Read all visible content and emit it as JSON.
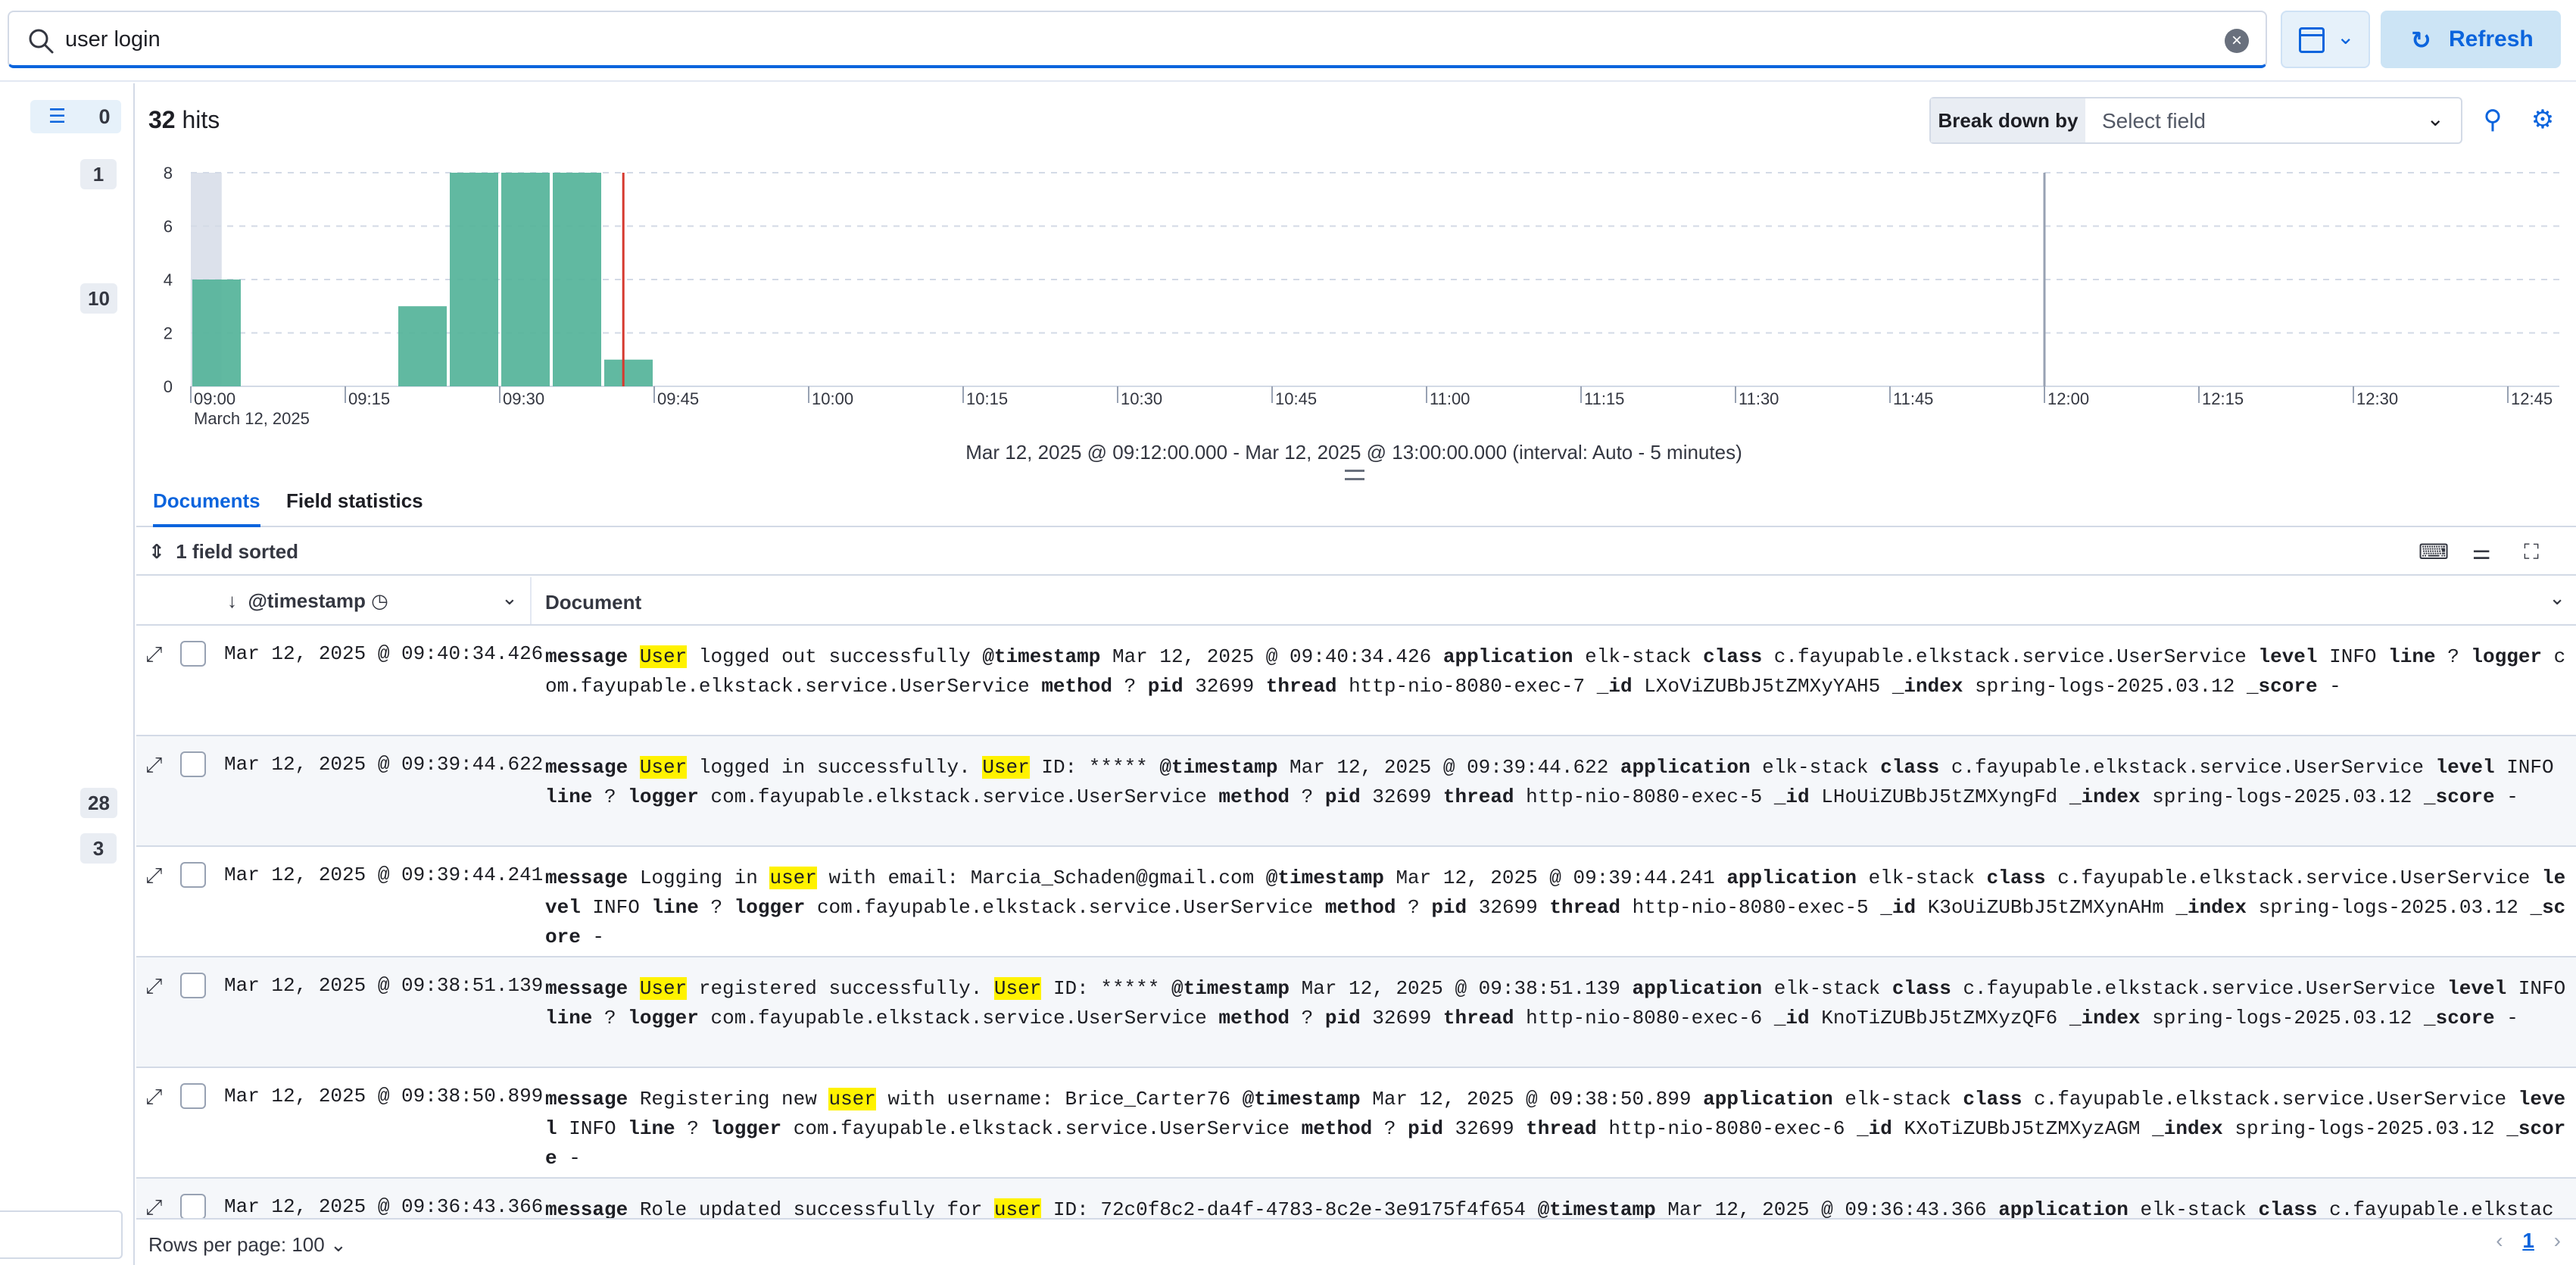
{
  "search": {
    "query": "user login"
  },
  "toolbar": {
    "refresh_label": "Refresh"
  },
  "sidebar": {
    "filter_count": "0",
    "counts": [
      {
        "value": "1"
      },
      {
        "value": "10"
      },
      {
        "value": "28"
      },
      {
        "value": "3"
      }
    ]
  },
  "results": {
    "hits_count": "32",
    "hits_label": "hits"
  },
  "breakdown": {
    "label": "Break down by",
    "placeholder": "Select field"
  },
  "chart_data": {
    "type": "bar",
    "x_unit": "time",
    "bin_minutes": 5,
    "bins": [
      {
        "start": "09:00",
        "value": 4
      },
      {
        "start": "09:05",
        "value": 0
      },
      {
        "start": "09:10",
        "value": 0
      },
      {
        "start": "09:15",
        "value": 0
      },
      {
        "start": "09:20",
        "value": 3
      },
      {
        "start": "09:25",
        "value": 8
      },
      {
        "start": "09:30",
        "value": 8
      },
      {
        "start": "09:35",
        "value": 8
      },
      {
        "start": "09:40",
        "value": 1
      }
    ],
    "x_ticks": [
      "09:00",
      "09:15",
      "09:30",
      "09:45",
      "10:00",
      "10:15",
      "10:30",
      "10:45",
      "11:00",
      "11:15",
      "11:30",
      "11:45",
      "12:00",
      "12:15",
      "12:30",
      "12:45"
    ],
    "x_sublabel": "March 12, 2025",
    "y_ticks": [
      0,
      2,
      4,
      6,
      8
    ],
    "ylim": [
      0,
      8
    ],
    "xlim": [
      "09:00",
      "12:50"
    ],
    "bar_color": "#54b399",
    "now_marker": "09:42",
    "out_of_range_before": "09:03",
    "end_marker": "12:00",
    "time_range": "Mar 12, 2025 @ 09:12:00.000 - Mar 12, 2025 @ 13:00:00.000 (interval: Auto - 5 minutes)"
  },
  "tabs": [
    {
      "label": "Documents",
      "active": true
    },
    {
      "label": "Field statistics",
      "active": false
    }
  ],
  "grid": {
    "sorted_label": "1 field sorted",
    "columns": {
      "timestamp": "@timestamp",
      "document": "Document"
    },
    "rows": [
      {
        "timestamp": "Mar 12, 2025 @ 09:40:34.426",
        "fields": [
          {
            "k": "message",
            "v": [
              {
                "t": "User",
                "hl": true
              },
              {
                "t": " logged out successfully"
              }
            ]
          },
          {
            "k": "@timestamp",
            "v": [
              {
                "t": "Mar 12, 2025 @ 09:40:34.426"
              }
            ]
          },
          {
            "k": "application",
            "v": [
              {
                "t": "elk-stack"
              }
            ]
          },
          {
            "k": "class",
            "v": [
              {
                "t": "c.fayupable.elkstack.service.UserService"
              }
            ]
          },
          {
            "k": "level",
            "v": [
              {
                "t": "INFO"
              }
            ]
          },
          {
            "k": "line",
            "v": [
              {
                "t": "?"
              }
            ]
          },
          {
            "k": "logger",
            "v": [
              {
                "t": "com.fayupable.elkstack.service.UserService"
              }
            ]
          },
          {
            "k": "method",
            "v": [
              {
                "t": "?"
              }
            ]
          },
          {
            "k": "pid",
            "v": [
              {
                "t": "32699"
              }
            ]
          },
          {
            "k": "thread",
            "v": [
              {
                "t": "http-nio-8080-exec-7"
              }
            ]
          },
          {
            "k": "_id",
            "v": [
              {
                "t": "LXoViZUBbJ5tZMXyYAH5"
              }
            ]
          },
          {
            "k": "_index",
            "v": [
              {
                "t": "spring-logs-2025.03.12"
              }
            ]
          },
          {
            "k": "_score",
            "v": [
              {
                "t": " -"
              }
            ]
          }
        ]
      },
      {
        "timestamp": "Mar 12, 2025 @ 09:39:44.622",
        "fields": [
          {
            "k": "message",
            "v": [
              {
                "t": "User",
                "hl": true
              },
              {
                "t": " logged in successfully. "
              },
              {
                "t": "User",
                "hl": true
              },
              {
                "t": " ID: *****"
              }
            ]
          },
          {
            "k": "@timestamp",
            "v": [
              {
                "t": "Mar 12, 2025 @ 09:39:44.622"
              }
            ]
          },
          {
            "k": "application",
            "v": [
              {
                "t": "elk-stack"
              }
            ]
          },
          {
            "k": "class",
            "v": [
              {
                "t": "c.fayupable.elkstack.service.UserService"
              }
            ]
          },
          {
            "k": "level",
            "v": [
              {
                "t": "INFO"
              }
            ]
          },
          {
            "k": "line",
            "v": [
              {
                "t": "?"
              }
            ]
          },
          {
            "k": "logger",
            "v": [
              {
                "t": "com.fayupable.elkstack.service.UserService"
              }
            ]
          },
          {
            "k": "method",
            "v": [
              {
                "t": "?"
              }
            ]
          },
          {
            "k": "pid",
            "v": [
              {
                "t": "32699"
              }
            ]
          },
          {
            "k": "thread",
            "v": [
              {
                "t": "http-nio-8080-exec-5"
              }
            ]
          },
          {
            "k": "_id",
            "v": [
              {
                "t": "LHoUiZUBbJ5tZMXyngFd"
              }
            ]
          },
          {
            "k": "_index",
            "v": [
              {
                "t": "spring-logs-2025.03.12"
              }
            ]
          },
          {
            "k": "_score",
            "v": [
              {
                "t": " -"
              }
            ]
          }
        ]
      },
      {
        "timestamp": "Mar 12, 2025 @ 09:39:44.241",
        "fields": [
          {
            "k": "message",
            "v": [
              {
                "t": "Logging in "
              },
              {
                "t": "user",
                "hl": true
              },
              {
                "t": " with email: Marcia_Schaden@gmail.com"
              }
            ]
          },
          {
            "k": "@timestamp",
            "v": [
              {
                "t": "Mar 12, 2025 @ 09:39:44.241"
              }
            ]
          },
          {
            "k": "application",
            "v": [
              {
                "t": "elk-stack"
              }
            ]
          },
          {
            "k": "class",
            "v": [
              {
                "t": "c.fayupable.elkstack.service.UserService"
              }
            ]
          },
          {
            "k": "level",
            "v": [
              {
                "t": "INFO"
              }
            ]
          },
          {
            "k": "line",
            "v": [
              {
                "t": "?"
              }
            ]
          },
          {
            "k": "logger",
            "v": [
              {
                "t": "com.fayupable.elkstack.service.UserService"
              }
            ]
          },
          {
            "k": "method",
            "v": [
              {
                "t": "?"
              }
            ]
          },
          {
            "k": "pid",
            "v": [
              {
                "t": "32699"
              }
            ]
          },
          {
            "k": "thread",
            "v": [
              {
                "t": "http-nio-8080-exec-5"
              }
            ]
          },
          {
            "k": "_id",
            "v": [
              {
                "t": "K3oUiZUBbJ5tZMXynAHm"
              }
            ]
          },
          {
            "k": "_index",
            "v": [
              {
                "t": "spring-logs-2025.03.12"
              }
            ]
          },
          {
            "k": "_score",
            "v": [
              {
                "t": " -"
              }
            ]
          }
        ]
      },
      {
        "timestamp": "Mar 12, 2025 @ 09:38:51.139",
        "fields": [
          {
            "k": "message",
            "v": [
              {
                "t": "User",
                "hl": true
              },
              {
                "t": " registered successfully. "
              },
              {
                "t": "User",
                "hl": true
              },
              {
                "t": " ID: *****"
              }
            ]
          },
          {
            "k": "@timestamp",
            "v": [
              {
                "t": "Mar 12, 2025 @ 09:38:51.139"
              }
            ]
          },
          {
            "k": "application",
            "v": [
              {
                "t": "elk-stack"
              }
            ]
          },
          {
            "k": "class",
            "v": [
              {
                "t": "c.fayupable.elkstack.service.UserService"
              }
            ]
          },
          {
            "k": "level",
            "v": [
              {
                "t": "INFO"
              }
            ]
          },
          {
            "k": "line",
            "v": [
              {
                "t": "?"
              }
            ]
          },
          {
            "k": "logger",
            "v": [
              {
                "t": "com.fayupable.elkstack.service.UserService"
              }
            ]
          },
          {
            "k": "method",
            "v": [
              {
                "t": "?"
              }
            ]
          },
          {
            "k": "pid",
            "v": [
              {
                "t": "32699"
              }
            ]
          },
          {
            "k": "thread",
            "v": [
              {
                "t": "http-nio-8080-exec-6"
              }
            ]
          },
          {
            "k": "_id",
            "v": [
              {
                "t": "KnoTiZUBbJ5tZMXyzQF6"
              }
            ]
          },
          {
            "k": "_index",
            "v": [
              {
                "t": "spring-logs-2025.03.12"
              }
            ]
          },
          {
            "k": "_score",
            "v": [
              {
                "t": " -"
              }
            ]
          }
        ]
      },
      {
        "timestamp": "Mar 12, 2025 @ 09:38:50.899",
        "fields": [
          {
            "k": "message",
            "v": [
              {
                "t": "Registering new "
              },
              {
                "t": "user",
                "hl": true
              },
              {
                "t": " with username: Brice_Carter76"
              }
            ]
          },
          {
            "k": "@timestamp",
            "v": [
              {
                "t": "Mar 12, 2025 @ 09:38:50.899"
              }
            ]
          },
          {
            "k": "application",
            "v": [
              {
                "t": "elk-stack"
              }
            ]
          },
          {
            "k": "class",
            "v": [
              {
                "t": "c.fayupable.elkstack.service.UserService"
              }
            ]
          },
          {
            "k": "level",
            "v": [
              {
                "t": "INFO"
              }
            ]
          },
          {
            "k": "line",
            "v": [
              {
                "t": "?"
              }
            ]
          },
          {
            "k": "logger",
            "v": [
              {
                "t": "com.fayupable.elkstack.service.UserService"
              }
            ]
          },
          {
            "k": "method",
            "v": [
              {
                "t": "?"
              }
            ]
          },
          {
            "k": "pid",
            "v": [
              {
                "t": "32699"
              }
            ]
          },
          {
            "k": "thread",
            "v": [
              {
                "t": "http-nio-8080-exec-6"
              }
            ]
          },
          {
            "k": "_id",
            "v": [
              {
                "t": "KXoTiZUBbJ5tZMXyzAGM"
              }
            ]
          },
          {
            "k": "_index",
            "v": [
              {
                "t": "spring-logs-2025.03.12"
              }
            ]
          },
          {
            "k": "_score",
            "v": [
              {
                "t": " -"
              }
            ]
          }
        ]
      },
      {
        "timestamp": "Mar 12, 2025 @ 09:36:43.366",
        "fields": [
          {
            "k": "message",
            "v": [
              {
                "t": "Role updated successfully for "
              },
              {
                "t": "user",
                "hl": true
              },
              {
                "t": " ID: 72c0f8c2-da4f-4783-8c2e-3e9175f4f654"
              }
            ]
          },
          {
            "k": "@timestamp",
            "v": [
              {
                "t": "Mar 12, 2025 @ 09:36:43.366"
              }
            ]
          },
          {
            "k": "application",
            "v": [
              {
                "t": "elk-stack"
              }
            ]
          },
          {
            "k": "class",
            "v": [
              {
                "t": "c.fayupable.elkstack.service.UserService"
              }
            ]
          }
        ]
      }
    ]
  },
  "footer": {
    "rows_per_page": "Rows per page: 100",
    "current_page": "1"
  },
  "colors": {
    "accent": "#0b64dd",
    "highlight": "#fff200",
    "bar": "#54b399"
  }
}
